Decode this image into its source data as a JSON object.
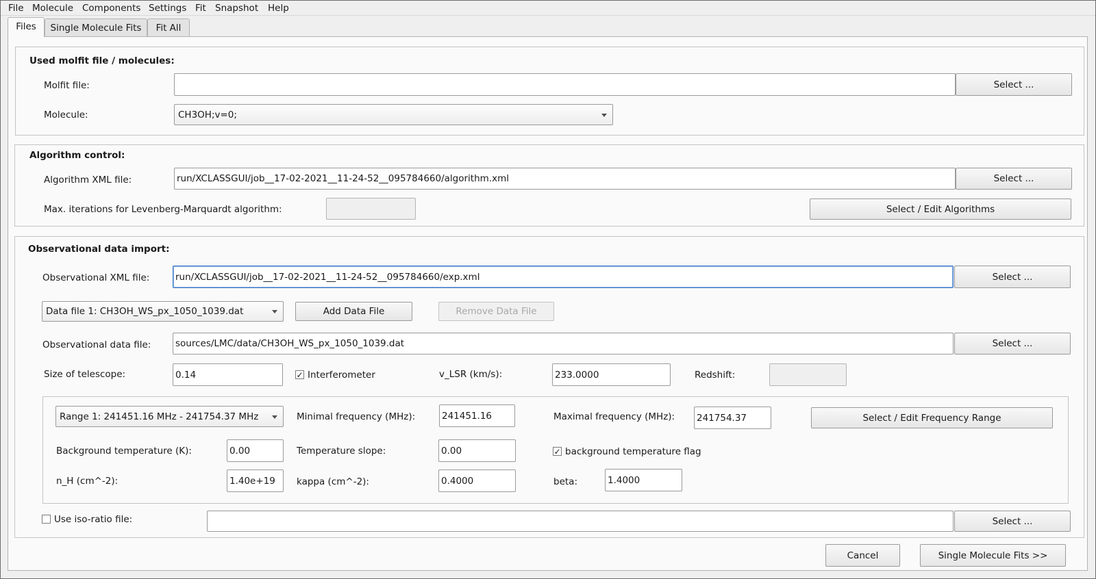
{
  "menu": [
    "File",
    "Molecule",
    "Components",
    "Settings",
    "Fit",
    "Snapshot",
    "Help"
  ],
  "tabs": [
    "Files",
    "Single Molecule Fits",
    "Fit All"
  ],
  "molfit_group": {
    "title": "Used molfit file / molecules:",
    "molfit_label": "Molfit file:",
    "molfit_value": "",
    "select_label": "Select ...",
    "molecule_label": "Molecule:",
    "molecule_value": "CH3OH;v=0;"
  },
  "algorithm_group": {
    "title": "Algorithm control:",
    "xml_label": "Algorithm XML file:",
    "xml_value": "run/XCLASSGUI/job__17-02-2021__11-24-52__095784660/algorithm.xml",
    "select_label": "Select ...",
    "max_iter_label": "Max. iterations for Levenberg-Marquardt algorithm:",
    "max_iter_value": "",
    "edit_algorithms_label": "Select / Edit Algorithms"
  },
  "obs_group": {
    "title": "Observational data import:",
    "xml_label": "Observational XML file:",
    "xml_value": "run/XCLASSGUI/job__17-02-2021__11-24-52__095784660/exp.xml",
    "select_label": "Select ...",
    "data_file_combo": "Data file 1: CH3OH_WS_px_1050_1039.dat",
    "add_data_file": "Add Data File",
    "remove_data_file": "Remove Data File",
    "data_file_label": "Observational data file:",
    "data_file_value": "sources/LMC/data/CH3OH_WS_px_1050_1039.dat",
    "telescope_label": "Size of telescope:",
    "telescope_value": "0.14",
    "interferometer_label": "Interferometer",
    "interferometer_checked": "✓",
    "vlsr_label": "v_LSR (km/s):",
    "vlsr_value": "233.0000",
    "redshift_label": "Redshift:",
    "redshift_value": "",
    "range": {
      "combo": "Range 1: 241451.16 MHz - 241754.37 MHz",
      "min_freq_label": "Minimal frequency (MHz):",
      "min_freq_value": "241451.16",
      "max_freq_label": "Maximal frequency (MHz):",
      "max_freq_value": "241754.37",
      "edit_range_label": "Select / Edit Frequency Range",
      "bg_temp_label": "Background temperature (K):",
      "bg_temp_value": "0.00",
      "temp_slope_label": "Temperature slope:",
      "temp_slope_value": "0.00",
      "bg_flag_label": "background temperature flag",
      "bg_flag_checked": "✓",
      "nh_label": "n_H (cm^-2):",
      "nh_value": "1.40e+19",
      "kappa_label": "kappa (cm^-2):",
      "kappa_value": "0.4000",
      "beta_label": "beta:",
      "beta_value": "1.4000"
    },
    "iso_label": "Use iso-ratio file:",
    "iso_checked": "",
    "iso_value": ""
  },
  "footer": {
    "cancel": "Cancel",
    "next": "Single Molecule Fits >>"
  }
}
